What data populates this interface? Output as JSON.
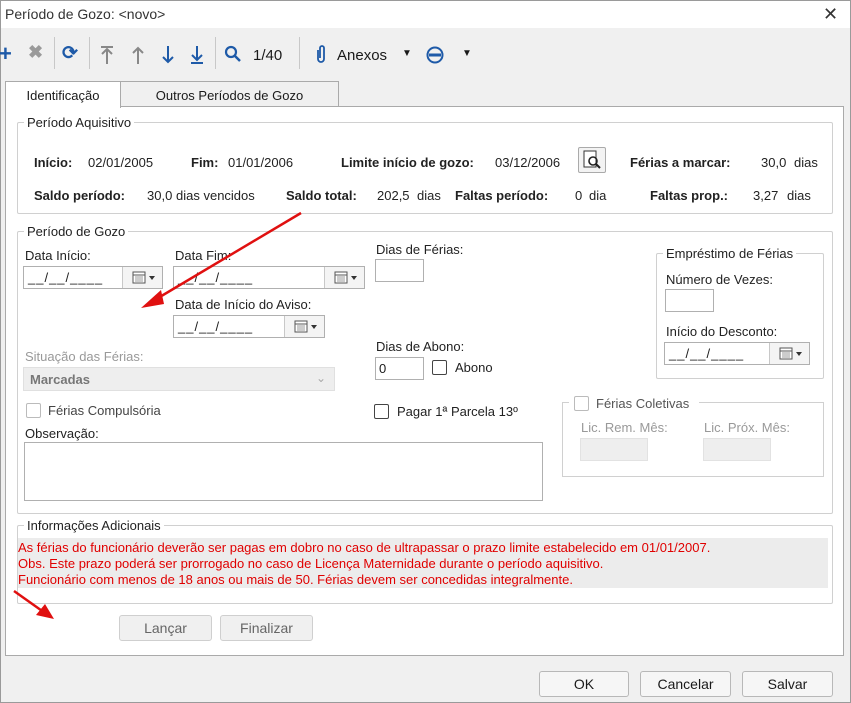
{
  "window": {
    "title": "Período de Gozo: <novo>",
    "close": "✕"
  },
  "toolbar": {
    "record_counter": "1/40",
    "attachments_label": "Anexos"
  },
  "tabs": [
    {
      "label": "Identificação",
      "active": true
    },
    {
      "label": "Outros Períodos de Gozo",
      "active": false
    }
  ],
  "periodo_aquisitivo": {
    "legend": "Período Aquisitivo",
    "inicio_label": "Início:",
    "inicio_value": "02/01/2005",
    "fim_label": "Fim:",
    "fim_value": "01/01/2006",
    "limite_label": "Limite início de gozo:",
    "limite_value": "03/12/2006",
    "ferias_marcar_label": "Férias a marcar:",
    "ferias_marcar_value": "30,0",
    "ferias_marcar_unit": "dias",
    "saldo_periodo_label": "Saldo período:",
    "saldo_periodo_value": "30,0",
    "saldo_periodo_unit": "dias vencidos",
    "saldo_total_label": "Saldo total:",
    "saldo_total_value": "202,5",
    "saldo_total_unit": "dias",
    "faltas_periodo_label": "Faltas período:",
    "faltas_periodo_value": "0",
    "faltas_periodo_unit": "dia",
    "faltas_prop_label": "Faltas prop.:",
    "faltas_prop_value": "3,27",
    "faltas_prop_unit": "dias"
  },
  "periodo_gozo": {
    "legend": "Período de Gozo",
    "data_inicio_label": "Data Início:",
    "data_inicio_value": "__/__/____",
    "data_fim_label": "Data Fim:",
    "data_fim_value": "__/__/____",
    "data_aviso_label": "Data de Início do Aviso:",
    "data_aviso_value": "__/__/____",
    "dias_ferias_label": "Dias de Férias:",
    "dias_ferias_value": "",
    "dias_abono_label": "Dias de Abono:",
    "dias_abono_value": "0",
    "abono_label": "Abono",
    "situacao_label": "Situação das Férias:",
    "situacao_value": "Marcadas",
    "compulsoria_label": "Férias Compulsória",
    "pagar_label": "Pagar 1ª Parcela 13º",
    "observacao_label": "Observação:"
  },
  "emprestimo": {
    "legend": "Empréstimo de Férias",
    "numero_vezes_label": "Número de Vezes:",
    "inicio_desconto_label": "Início do Desconto:",
    "inicio_desconto_value": "__/__/____"
  },
  "ferias_coletivas": {
    "label": "Férias Coletivas",
    "lic_rem_label": "Lic. Rem. Mês:",
    "lic_prox_label": "Lic. Próx. Mês:"
  },
  "info": {
    "legend": "Informações Adicionais",
    "lines": [
      "As férias do funcionário deverão ser pagas em dobro no caso de ultrapassar o prazo limite estabelecido em 01/01/2007.",
      "Obs. Este prazo poderá ser prorrogado no caso de Licença Maternidade durante o período aquisitivo.",
      "Funcionário com menos de 18 anos ou mais de 50. Férias devem ser concedidas integralmente."
    ],
    "text_color": "#e00000"
  },
  "buttons": {
    "lancar": "Lançar",
    "finalizar": "Finalizar",
    "ok": "OK",
    "cancelar": "Cancelar",
    "salvar": "Salvar"
  },
  "colors": {
    "accent": "#1e5aa8",
    "annotation_arrow": "#e01010"
  }
}
